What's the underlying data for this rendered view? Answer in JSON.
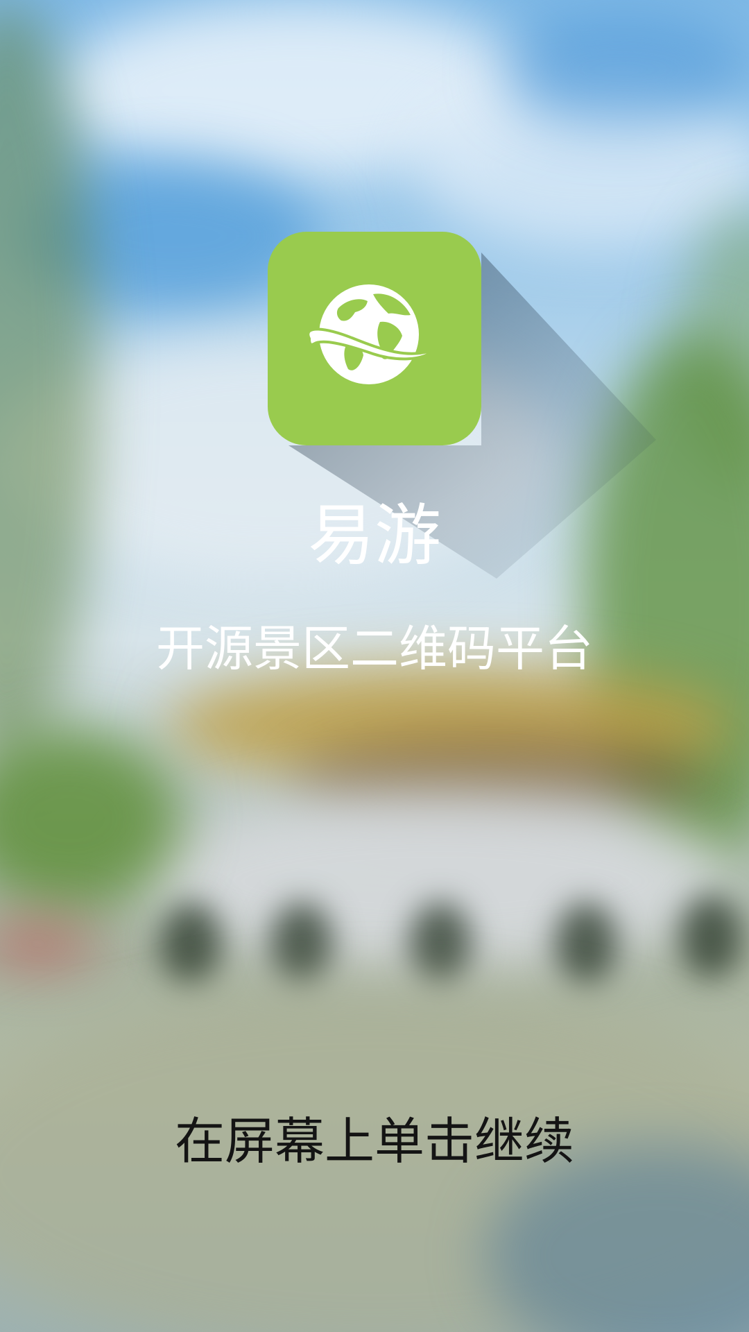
{
  "app": {
    "name": "易游",
    "subtitle": "开源景区二维码平台",
    "logo_icon": "globe-with-orbit-icon",
    "brand_color": "#99cb4e"
  },
  "prompt": {
    "tap_to_continue": "在屏幕上单击继续"
  },
  "background": {
    "description_icon": "blurred-scenic-pavilion-background"
  }
}
